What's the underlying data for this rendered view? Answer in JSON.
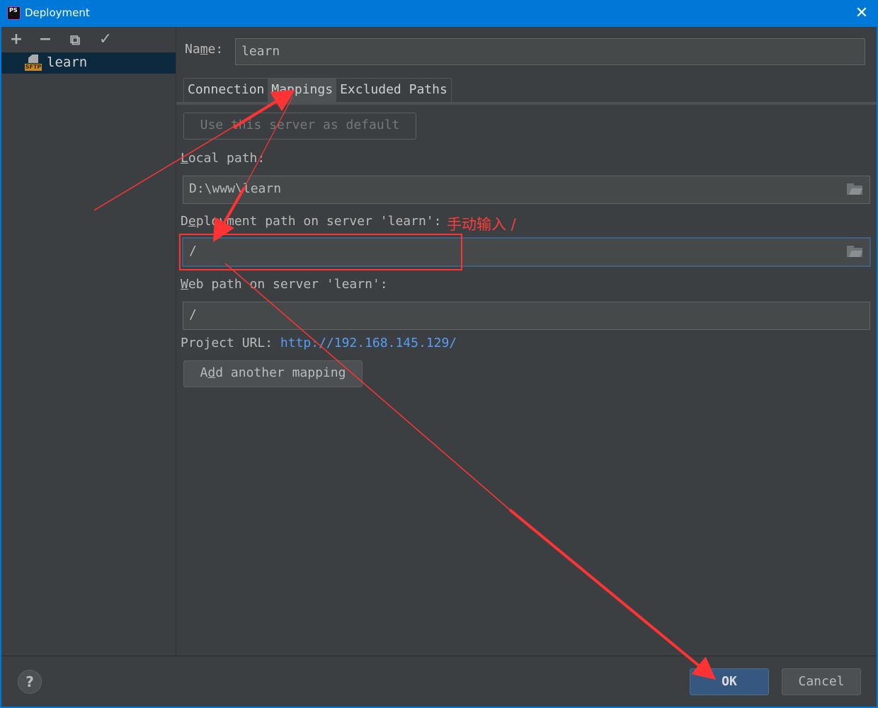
{
  "window": {
    "title": "Deployment",
    "app_icon": "phpstorm-icon",
    "close_icon": "close-icon",
    "close_glyph": "✕"
  },
  "sidebar": {
    "toolbar": [
      {
        "name": "add-icon",
        "glyph": "+"
      },
      {
        "name": "remove-icon",
        "glyph": "−"
      },
      {
        "name": "copy-icon",
        "glyph": "⧉"
      },
      {
        "name": "check-icon",
        "glyph": "✓"
      }
    ],
    "servers": [
      {
        "name": "learn",
        "type_badge": "SFTP",
        "selected": true
      }
    ]
  },
  "form": {
    "name_label_pre": "Na",
    "name_label_mn": "m",
    "name_label_post": "e:",
    "name_value": "learn",
    "tabs": [
      {
        "label": "Connection",
        "active": false
      },
      {
        "label": "Mappings",
        "active": true
      },
      {
        "label": "Excluded Paths",
        "active": false
      }
    ],
    "default_button": "Use this server as default",
    "local_path_label_mn": "L",
    "local_path_label_rest": "ocal path:",
    "local_path_value": "D:\\www\\learn",
    "deploy_path_label_pre": "D",
    "deploy_path_label_mn": "e",
    "deploy_path_label_rest": "ployment path on server 'learn':",
    "deploy_path_value": "/",
    "web_path_label_mn": "W",
    "web_path_label_rest": "eb path on server 'learn':",
    "web_path_value": "/",
    "project_url_label": "Project URL:",
    "project_url": "http://192.168.145.129/",
    "add_mapping_pre": "A",
    "add_mapping_mn": "d",
    "add_mapping_post": "d another mapping"
  },
  "footer": {
    "help_glyph": "?",
    "ok": "OK",
    "cancel": "Cancel"
  },
  "annotation": {
    "note": "手动输入 /",
    "color": "#ff3333"
  }
}
